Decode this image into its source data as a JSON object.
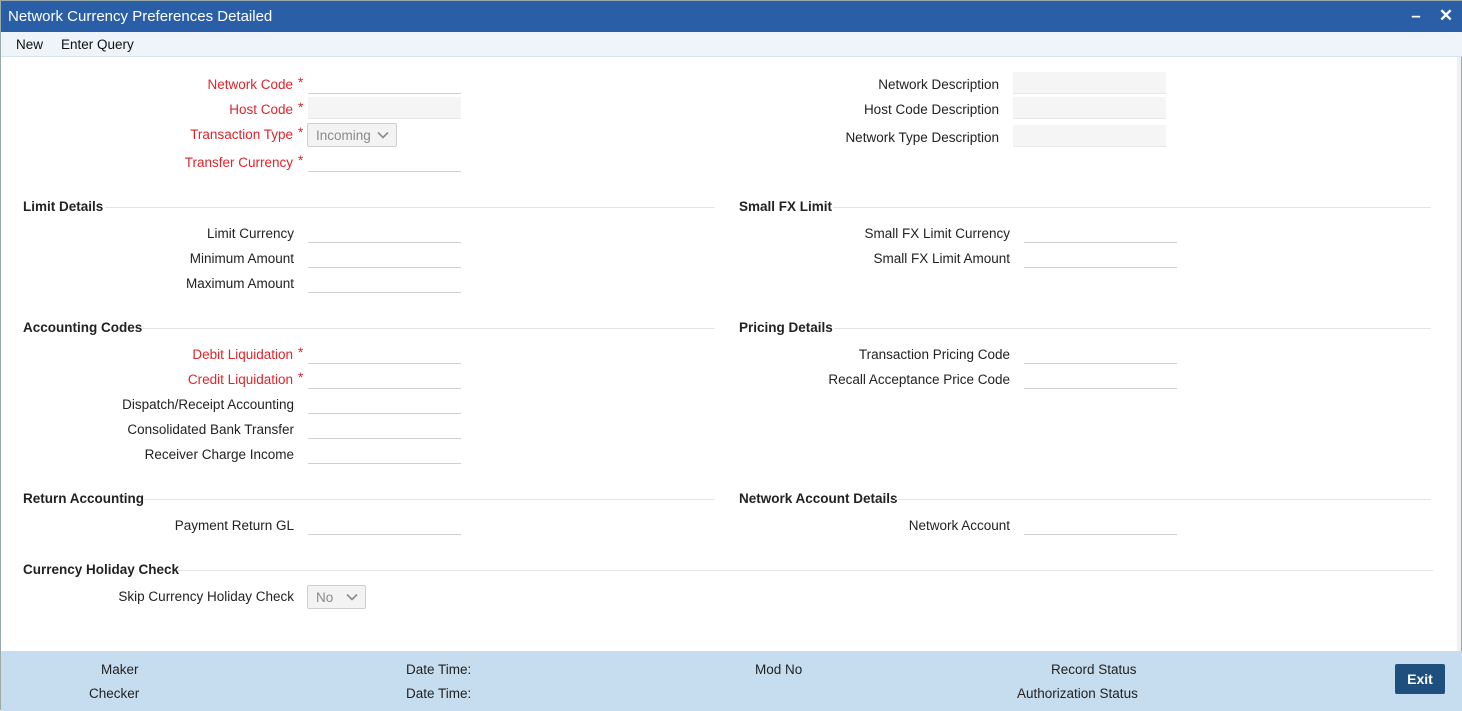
{
  "window": {
    "title": "Network Currency Preferences Detailed",
    "minimize_label": "–",
    "close_label": "✕"
  },
  "menu": {
    "new_label": "New",
    "enter_query_label": "Enter Query"
  },
  "header": {
    "network_code_label": "Network Code",
    "host_code_label": "Host Code",
    "transaction_type_label": "Transaction Type",
    "transaction_type_value": "Incoming",
    "transfer_currency_label": "Transfer Currency",
    "network_description_label": "Network Description",
    "host_code_description_label": "Host Code Description",
    "network_type_description_label": "Network Type Description",
    "required_marker": "*"
  },
  "limit_details": {
    "title": "Limit Details",
    "limit_currency_label": "Limit Currency",
    "minimum_amount_label": "Minimum Amount",
    "maximum_amount_label": "Maximum Amount"
  },
  "small_fx_limit": {
    "title": "Small FX Limit",
    "currency_label": "Small FX Limit Currency",
    "amount_label": "Small FX Limit Amount"
  },
  "accounting_codes": {
    "title": "Accounting Codes",
    "debit_liquidation_label": "Debit Liquidation",
    "credit_liquidation_label": "Credit Liquidation",
    "dispatch_receipt_label": "Dispatch/Receipt Accounting",
    "consolidated_bank_transfer_label": "Consolidated Bank Transfer",
    "receiver_charge_income_label": "Receiver Charge Income"
  },
  "pricing_details": {
    "title": "Pricing Details",
    "transaction_pricing_code_label": "Transaction Pricing Code",
    "recall_acceptance_price_code_label": "Recall Acceptance Price Code"
  },
  "return_accounting": {
    "title": "Return Accounting",
    "payment_return_gl_label": "Payment Return GL"
  },
  "network_account_details": {
    "title": "Network Account Details",
    "network_account_label": "Network Account"
  },
  "currency_holiday_check": {
    "title": "Currency Holiday Check",
    "skip_label": "Skip Currency Holiday Check",
    "skip_value": "No"
  },
  "footer": {
    "maker_label": "Maker",
    "checker_label": "Checker",
    "date_time_label_1": "Date Time:",
    "date_time_label_2": "Date Time:",
    "mod_no_label": "Mod No",
    "record_status_label": "Record Status",
    "authorization_status_label": "Authorization Status",
    "exit_label": "Exit"
  },
  "colors": {
    "title_bar": "#2a5fa8",
    "required": "#e0242b",
    "footer": "#c5ddef",
    "exit_button": "#1f4f7d"
  },
  "icons": {
    "minimize": "minimize-icon",
    "close": "close-icon",
    "dropdown": "chevron-down-icon"
  }
}
